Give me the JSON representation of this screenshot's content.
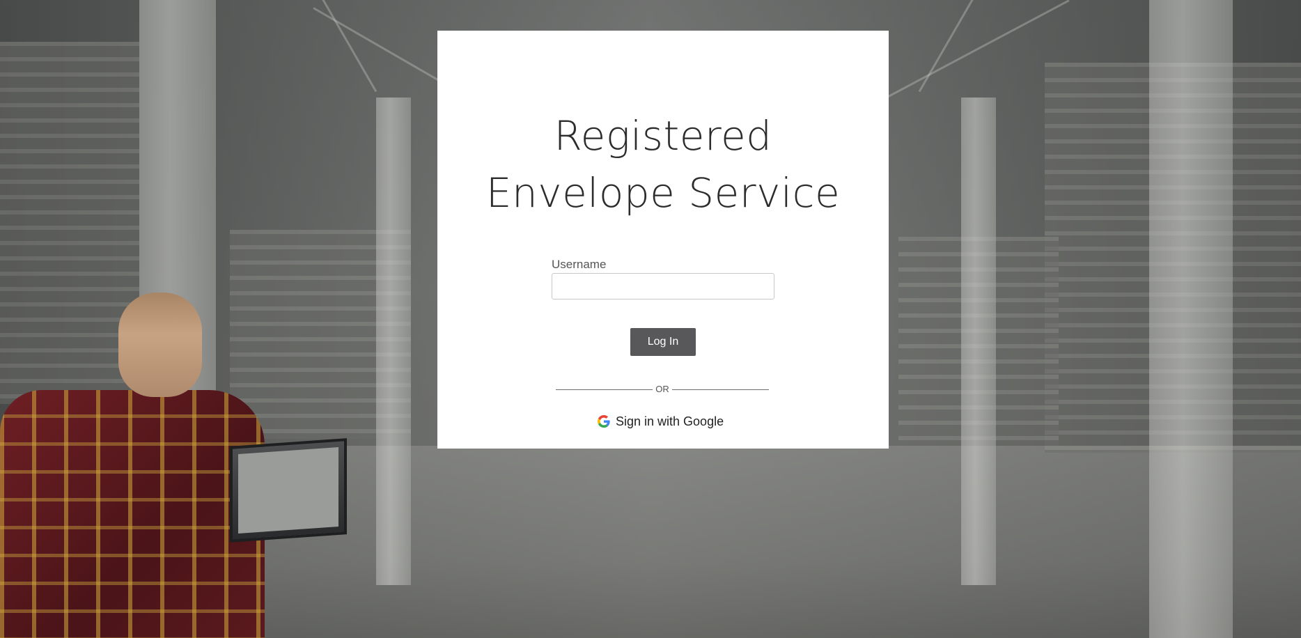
{
  "page": {
    "title_lines": [
      "Registered",
      "Envelope Service"
    ]
  },
  "login_form": {
    "username_label": "Username",
    "username_value": "",
    "username_placeholder": "",
    "login_button_label": "Log In",
    "divider_text": "OR",
    "google_signin_label": "Sign in with Google",
    "google_icon": "google-g-icon"
  },
  "colors": {
    "card_background": "#ffffff",
    "login_button": "#58585a",
    "google_blue": "#4285F4",
    "google_red": "#EA4335",
    "google_yellow": "#FBBC05",
    "google_green": "#34A853"
  }
}
